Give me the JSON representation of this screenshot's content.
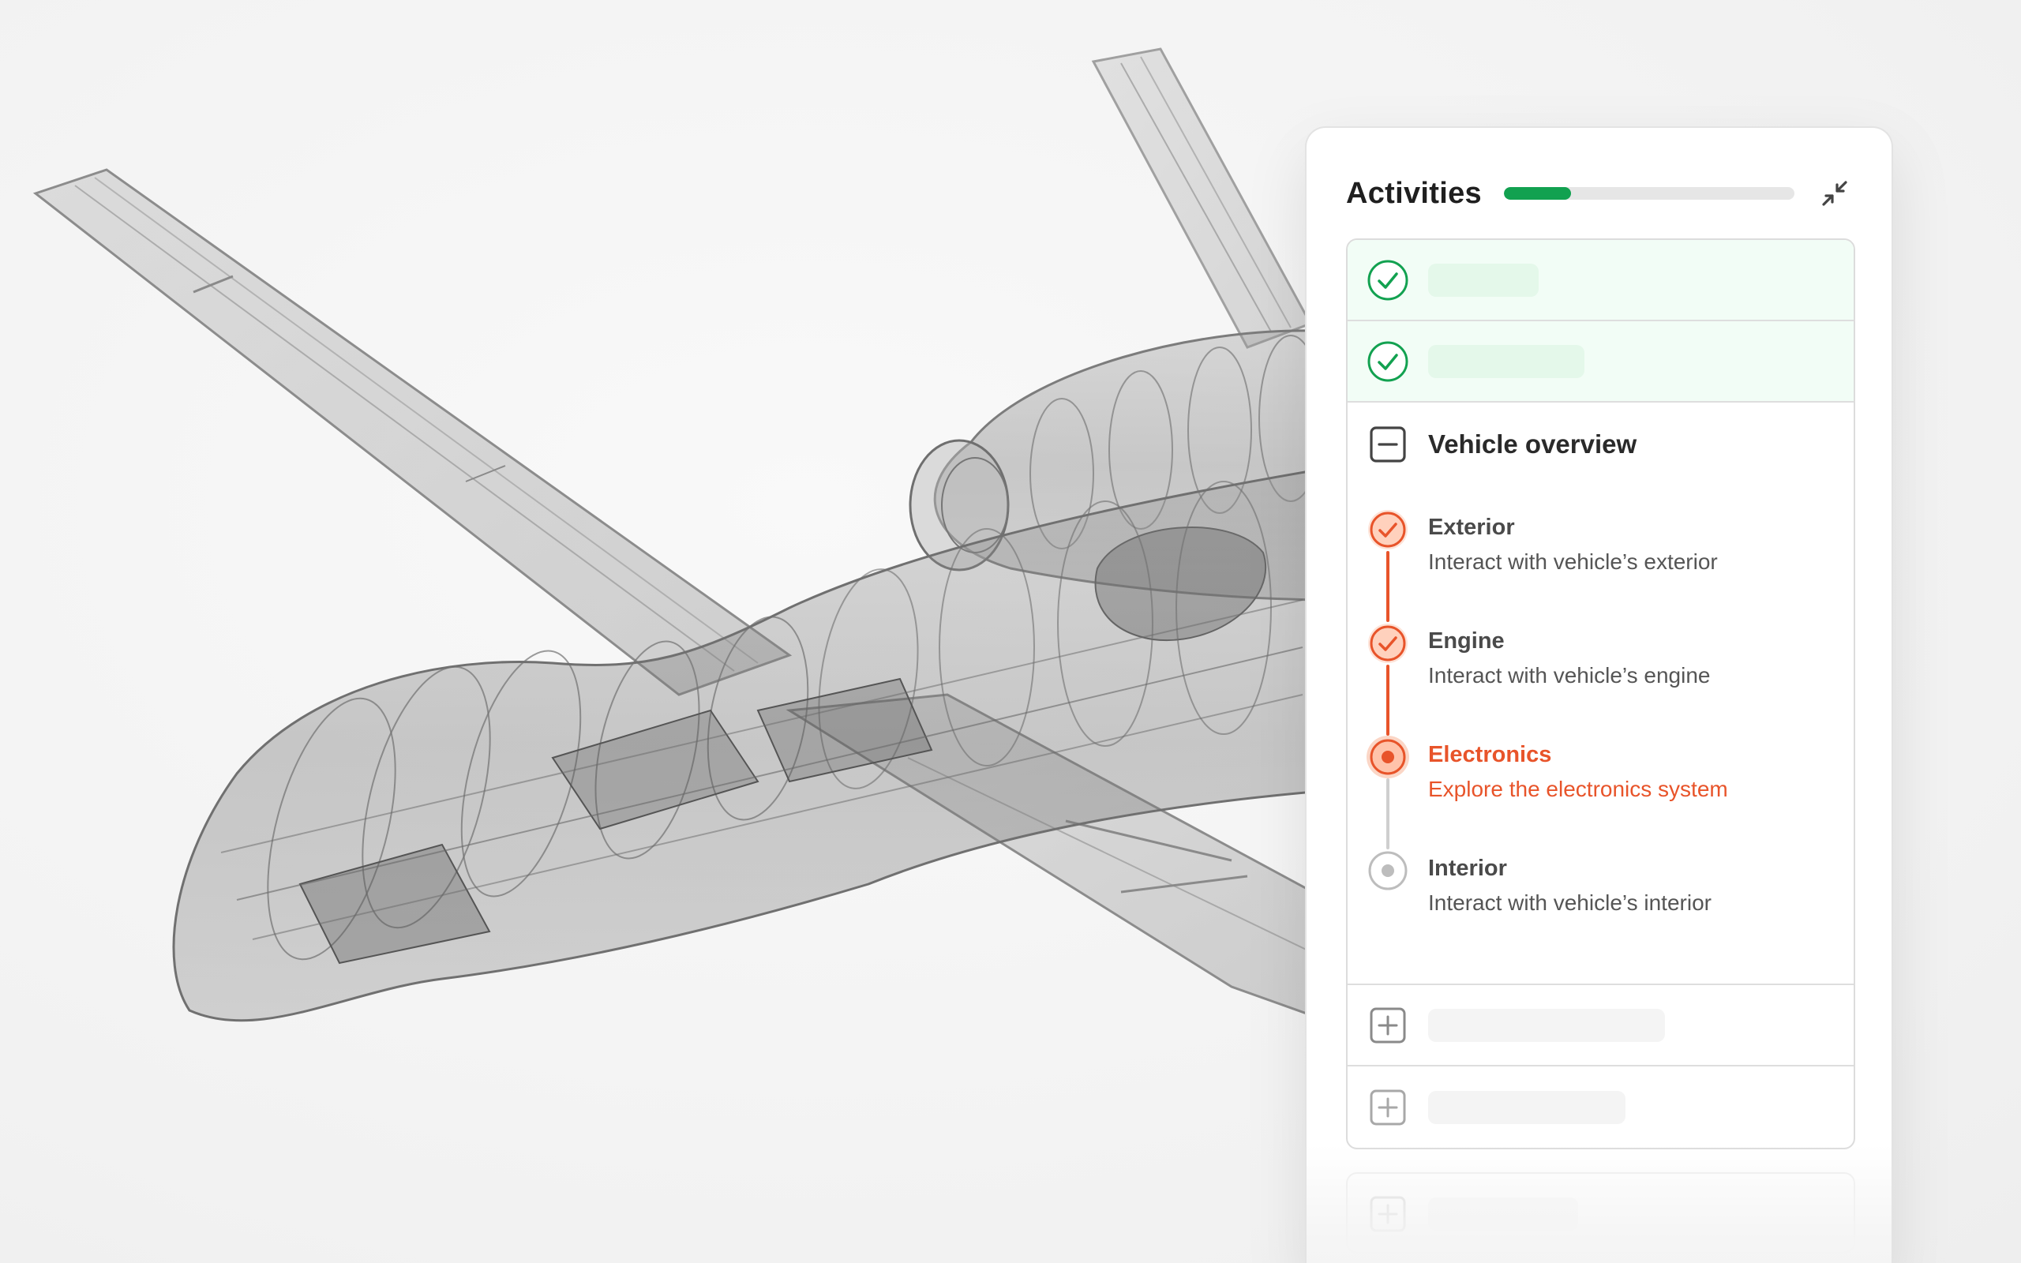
{
  "panel": {
    "title": "Activities",
    "progress_percent": 23
  },
  "sections": {
    "current": {
      "title": "Vehicle overview",
      "steps": [
        {
          "title": "Exterior",
          "description": "Interact with vehicle’s exterior",
          "status": "done"
        },
        {
          "title": "Engine",
          "description": "Interact with vehicle’s engine",
          "status": "done"
        },
        {
          "title": "Electronics",
          "description": "Explore the electronics system",
          "status": "active"
        },
        {
          "title": "Interior",
          "description": "Interact with vehicle’s interior",
          "status": "todo"
        }
      ]
    }
  },
  "icons": {
    "collapse": "collapse-arrows-icon",
    "done": "check-circle-icon",
    "section_open": "minus-square-icon",
    "section_closed": "plus-square-icon",
    "step_done": "check-circle-icon",
    "step_active": "dot-circle-icon",
    "step_todo": "empty-circle-icon"
  },
  "colors": {
    "success": "#12a150",
    "accent": "#e8542a",
    "muted": "#cfcfcf",
    "text": "#1f1f1f"
  }
}
